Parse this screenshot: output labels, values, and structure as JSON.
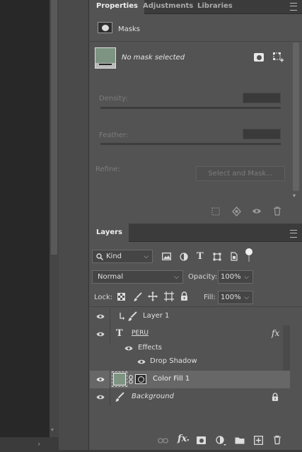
{
  "properties": {
    "tabs": [
      {
        "label": "Properties",
        "active": true
      },
      {
        "label": "Adjustments",
        "active": false
      },
      {
        "label": "Libraries",
        "active": false
      }
    ],
    "section_title": "Masks",
    "mask_status": "No mask selected",
    "density_label": "Density:",
    "feather_label": "Feather:",
    "refine_label": "Refine:",
    "select_and_mask_label": "Select and Mask..."
  },
  "layers_panel": {
    "tab_label": "Layers",
    "filter_kind": "Kind",
    "blend_mode": "Normal",
    "opacity_label": "Opacity:",
    "opacity_value": "100%",
    "lock_label": "Lock:",
    "fill_label": "Fill:",
    "fill_value": "100%",
    "layers": [
      {
        "name": "Layer 1",
        "type": "paint",
        "visible": true
      },
      {
        "name": "PERU",
        "type": "text",
        "visible": true,
        "has_fx": true,
        "fx_label": "fx",
        "effects_label": "Effects",
        "effects": [
          "Drop Shadow"
        ]
      },
      {
        "name": "Color Fill 1",
        "type": "fill",
        "visible": true,
        "selected": true
      },
      {
        "name": "Background",
        "type": "background",
        "visible": true,
        "locked": true
      }
    ]
  },
  "colors": {
    "panel_bg": "#535353",
    "selected_row": "#676767",
    "color_fill_swatch": "#7d9482",
    "tab_bar": "#3b3b3b"
  }
}
